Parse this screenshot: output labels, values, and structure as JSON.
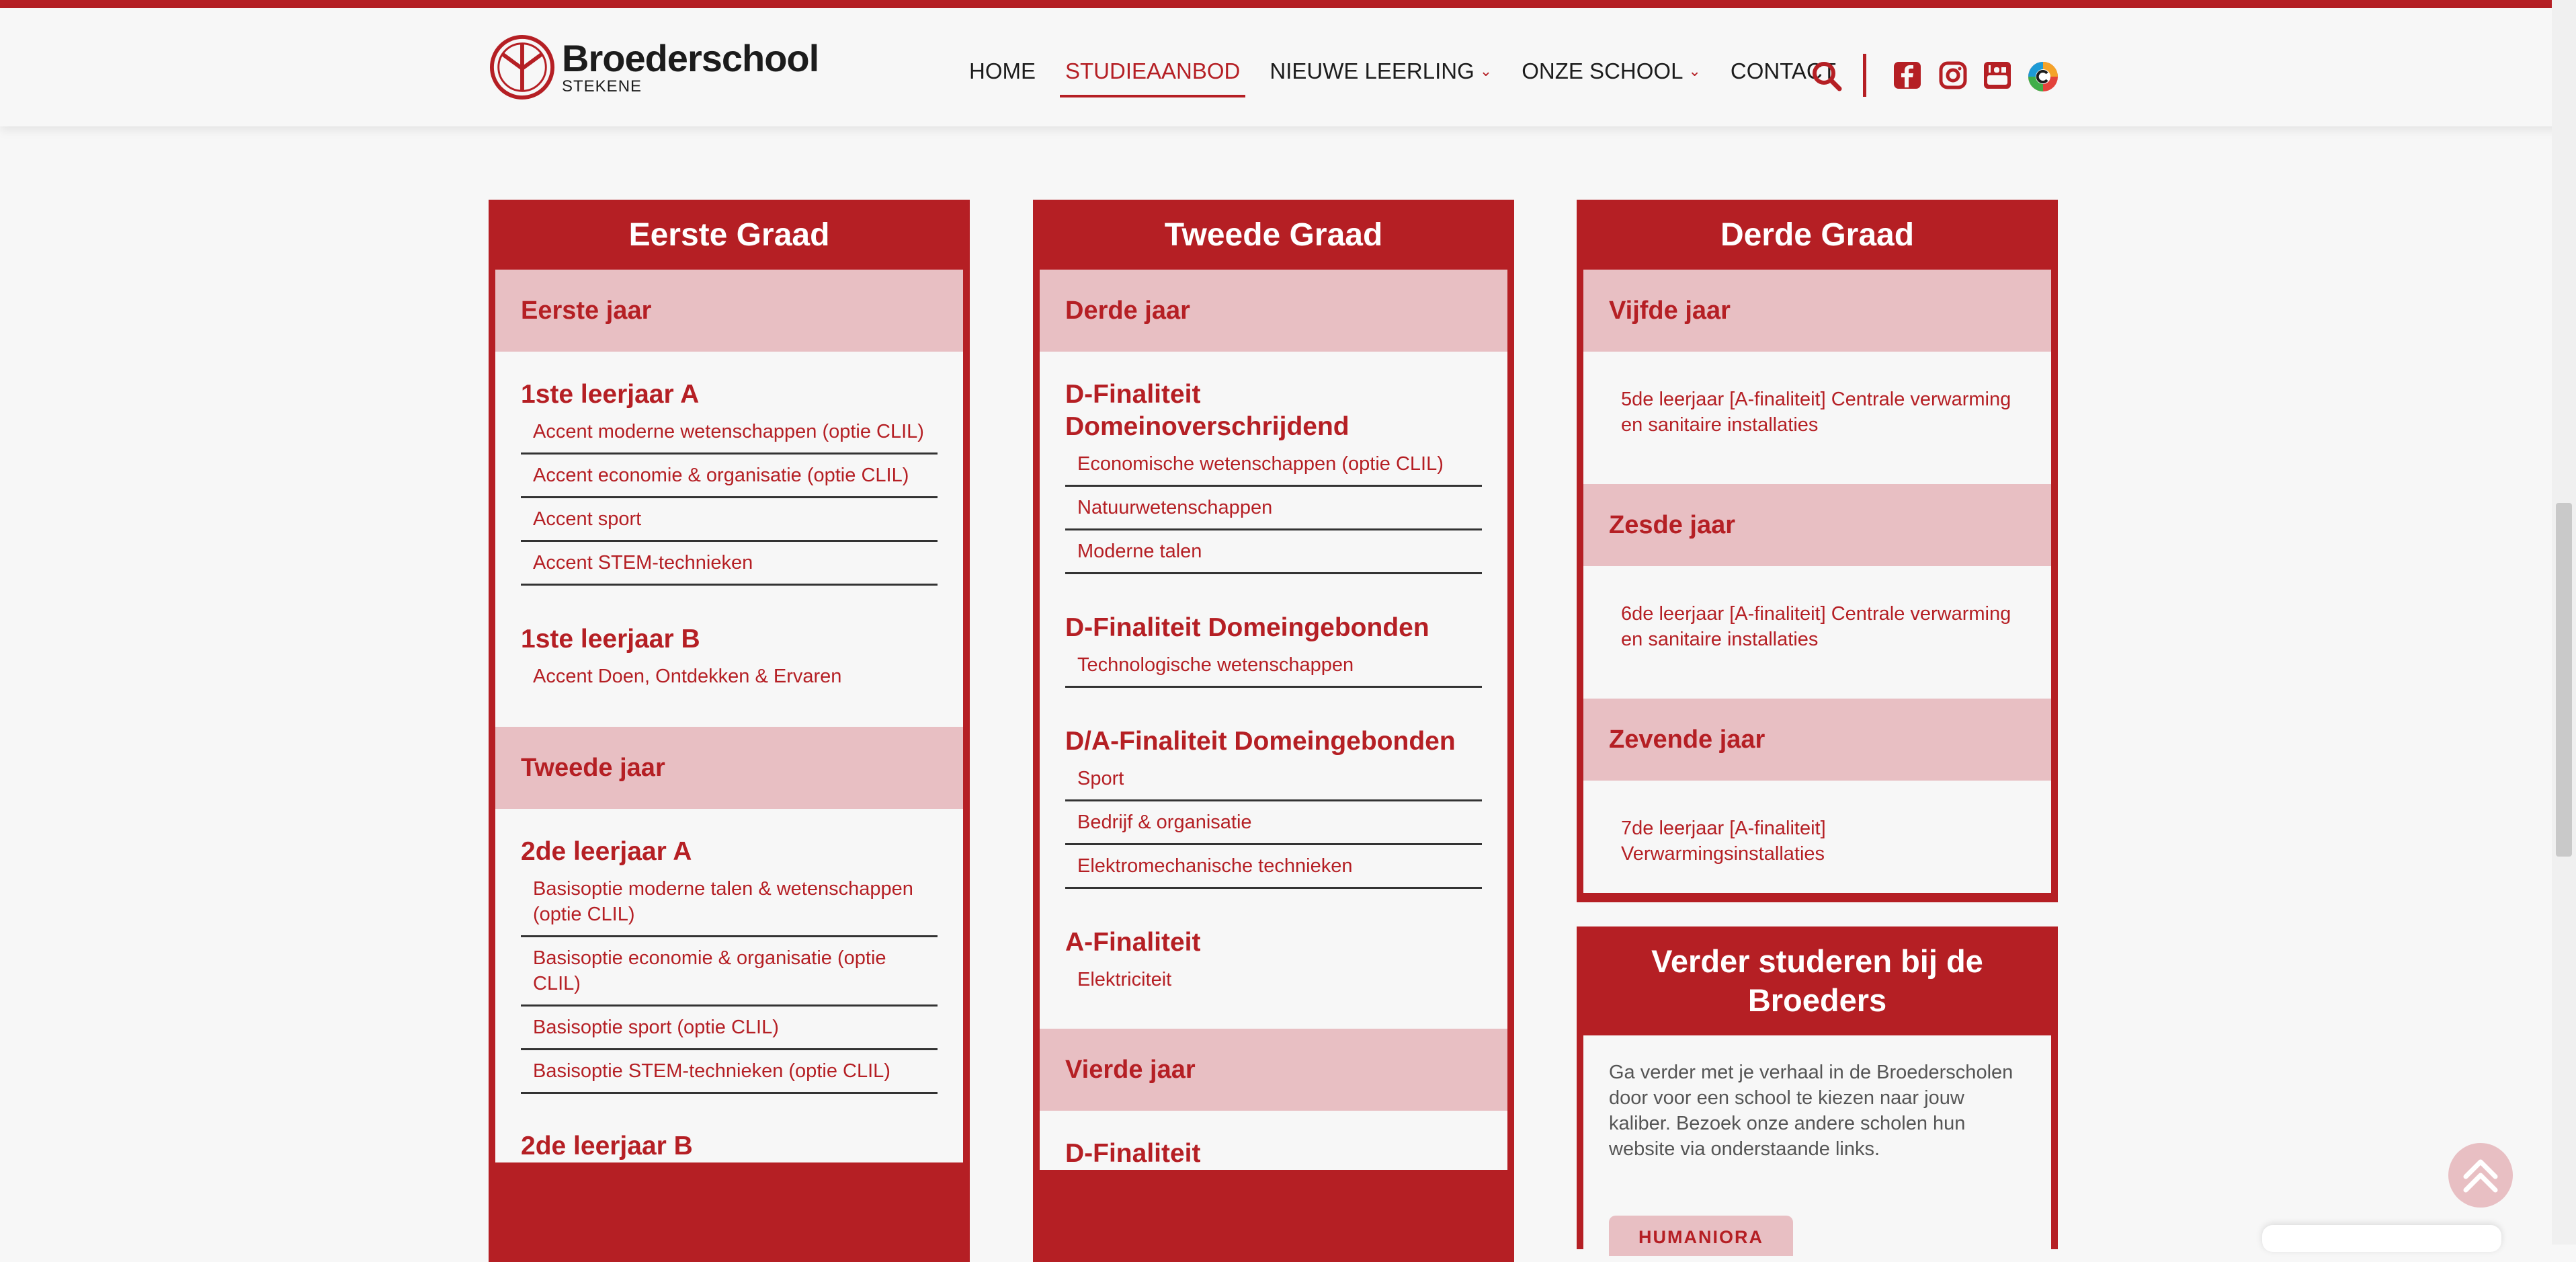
{
  "brand": {
    "name": "Broederschool",
    "location": "STEKENE",
    "accent": "#b51f24",
    "light": "#e8bfc3"
  },
  "nav": {
    "items": [
      {
        "label": "HOME",
        "active": false,
        "dropdown": false
      },
      {
        "label": "STUDIEAANBOD",
        "active": true,
        "dropdown": false
      },
      {
        "label": "NIEUWE LEERLING",
        "active": false,
        "dropdown": true
      },
      {
        "label": "ONZE SCHOOL",
        "active": false,
        "dropdown": true
      },
      {
        "label": "CONTACT",
        "active": false,
        "dropdown": false
      }
    ],
    "icons": [
      "search-icon",
      "facebook-icon",
      "instagram-icon",
      "youtube-icon",
      "smartschool-icon"
    ]
  },
  "col1": {
    "title": "Eerste Graad",
    "year1": "Eerste jaar",
    "groupA": {
      "title": "1ste leerjaar A",
      "items": [
        "Accent moderne wetenschappen (optie CLIL)",
        "Accent economie & organisatie (optie CLIL)",
        "Accent sport",
        "Accent STEM-technieken"
      ]
    },
    "groupB": {
      "title": "1ste leerjaar B",
      "items": [
        "Accent Doen, Ontdekken & Ervaren"
      ]
    },
    "year2": "Tweede jaar",
    "groupC": {
      "title": "2de leerjaar A",
      "items": [
        "Basisoptie moderne talen & wetenschappen (optie CLIL)",
        "Basisoptie economie & organisatie (optie CLIL)",
        "Basisoptie sport (optie CLIL)",
        "Basisoptie STEM-technieken (optie CLIL)"
      ]
    },
    "groupD": {
      "title": "2de leerjaar B"
    }
  },
  "col2": {
    "title": "Tweede Graad",
    "year1": "Derde jaar",
    "groupA": {
      "title": "D-Finaliteit Domeinoverschrijdend",
      "items": [
        "Economische wetenschappen (optie CLIL)",
        "Natuurwetenschappen",
        "Moderne talen"
      ]
    },
    "groupB": {
      "title": "D-Finaliteit Domeingebonden",
      "items": [
        "Technologische wetenschappen"
      ]
    },
    "groupC": {
      "title": "D/A-Finaliteit Domeingebonden",
      "items": [
        "Sport",
        "Bedrijf & organisatie",
        "Elektromechanische technieken"
      ]
    },
    "groupD": {
      "title": "A-Finaliteit",
      "items": [
        "Elektriciteit"
      ]
    },
    "year2": "Vierde jaar",
    "groupE": {
      "title": "D-Finaliteit"
    }
  },
  "col3": {
    "title": "Derde Graad",
    "year1": "Vijfde jaar",
    "item1": "5de leerjaar [A-finaliteit] Centrale verwarming en sanitaire installaties",
    "year2": "Zesde jaar",
    "item2": "6de leerjaar [A-finaliteit] Centrale verwarming en sanitaire installaties",
    "year3": "Zevende jaar",
    "item3": "7de leerjaar [A-finaliteit] Verwarmingsinstallaties"
  },
  "verder": {
    "title": "Verder studeren bij de Broeders",
    "body": "Ga verder met je verhaal in de Broederscholen door voor een school te kiezen naar jouw kaliber. Bezoek onze andere scholen hun website via onderstaande links.",
    "button": "HUMANIORA"
  }
}
